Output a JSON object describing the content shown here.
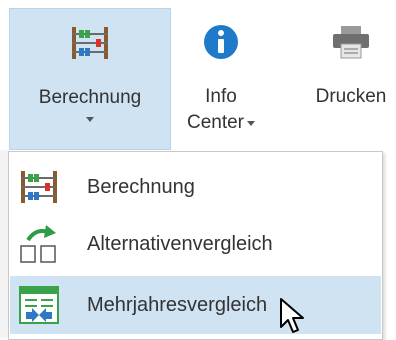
{
  "ribbon": {
    "buttons": [
      {
        "label": "Berechnung",
        "icon": "abacus-icon"
      },
      {
        "label_line1": "Info",
        "label_line2": "Center",
        "icon": "info-icon"
      },
      {
        "label": "Drucken",
        "icon": "printer-icon"
      }
    ]
  },
  "menu": {
    "items": [
      {
        "label": "Berechnung",
        "icon": "abacus-icon"
      },
      {
        "label": "Alternativenvergleich",
        "icon": "compare-alternatives-icon"
      },
      {
        "label": "Mehrjahresvergleich",
        "icon": "multi-year-comparison-icon"
      }
    ]
  },
  "colors": {
    "selected_bg": "#cfe3f3",
    "info_blue": "#1f7bc9"
  }
}
